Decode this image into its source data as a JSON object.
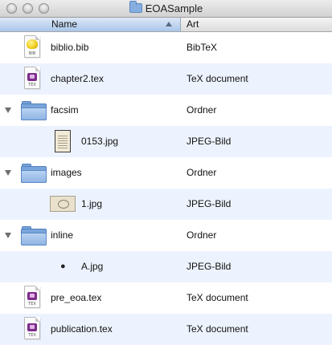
{
  "window": {
    "title": "EOASample"
  },
  "columns": {
    "name": "Name",
    "kind": "Art"
  },
  "rows": [
    {
      "name": "biblio.bib",
      "kind": "BibTeX",
      "icon": "bibtex-file-icon",
      "icon_label": "BIB"
    },
    {
      "name": "chapter2.tex",
      "kind": "TeX document",
      "icon": "tex-file-icon",
      "icon_label": "TEX"
    },
    {
      "name": "facsim",
      "kind": "Ordner",
      "icon": "folder-icon",
      "expanded": true
    },
    {
      "name": "0153.jpg",
      "kind": "JPEG-Bild",
      "icon": "jpeg-thumbnail-icon"
    },
    {
      "name": "images",
      "kind": "Ordner",
      "icon": "folder-icon",
      "expanded": true
    },
    {
      "name": "1.jpg",
      "kind": "JPEG-Bild",
      "icon": "jpeg-thumbnail-icon"
    },
    {
      "name": "inline",
      "kind": "Ordner",
      "icon": "folder-icon",
      "expanded": true
    },
    {
      "name": "A.jpg",
      "kind": "JPEG-Bild",
      "icon": "apple-logo-icon"
    },
    {
      "name": "pre_eoa.tex",
      "kind": "TeX document",
      "icon": "tex-file-icon",
      "icon_label": "TEX"
    },
    {
      "name": "publication.tex",
      "kind": "TeX document",
      "icon": "tex-file-icon",
      "icon_label": "TEX"
    }
  ]
}
